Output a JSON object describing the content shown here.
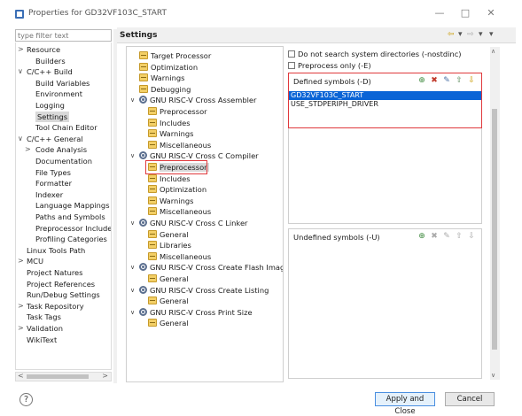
{
  "window": {
    "title": "Properties for GD32VF103C_START",
    "minimize": "—",
    "maximize": "□",
    "close": "✕"
  },
  "filter": {
    "placeholder": "type filter text"
  },
  "nav": {
    "items": [
      {
        "label": "Resource",
        "arrow": ">"
      },
      {
        "label": "Builders"
      },
      {
        "label": "C/C++ Build",
        "arrow": "∨"
      },
      {
        "label": "Build Variables"
      },
      {
        "label": "Environment"
      },
      {
        "label": "Logging"
      },
      {
        "label": "Settings"
      },
      {
        "label": "Tool Chain Editor"
      },
      {
        "label": "C/C++ General",
        "arrow": "∨"
      },
      {
        "label": "Code Analysis",
        "arrow": ">"
      },
      {
        "label": "Documentation"
      },
      {
        "label": "File Types"
      },
      {
        "label": "Formatter"
      },
      {
        "label": "Indexer"
      },
      {
        "label": "Language Mappings"
      },
      {
        "label": "Paths and Symbols"
      },
      {
        "label": "Preprocessor Include"
      },
      {
        "label": "Profiling Categories"
      },
      {
        "label": "Linux Tools Path"
      },
      {
        "label": "MCU",
        "arrow": ">"
      },
      {
        "label": "Project Natures"
      },
      {
        "label": "Project References"
      },
      {
        "label": "Run/Debug Settings"
      },
      {
        "label": "Task Repository",
        "arrow": ">"
      },
      {
        "label": "Task Tags"
      },
      {
        "label": "Validation",
        "arrow": ">"
      },
      {
        "label": "WikiText"
      }
    ]
  },
  "settings": {
    "title": "Settings",
    "nav_back": "⇦",
    "nav_menu": "▾",
    "nav_forward": "⇨"
  },
  "tool_tree": {
    "nodes": [
      {
        "label": "Target Processor"
      },
      {
        "label": "Optimization"
      },
      {
        "label": "Warnings"
      },
      {
        "label": "Debugging"
      },
      {
        "label": "GNU RISC-V Cross Assembler",
        "arrow": "∨"
      },
      {
        "label": "Preprocessor"
      },
      {
        "label": "Includes"
      },
      {
        "label": "Warnings"
      },
      {
        "label": "Miscellaneous"
      },
      {
        "label": "GNU RISC-V Cross C Compiler",
        "arrow": "∨"
      },
      {
        "label": "Preprocessor"
      },
      {
        "label": "Includes"
      },
      {
        "label": "Optimization"
      },
      {
        "label": "Warnings"
      },
      {
        "label": "Miscellaneous"
      },
      {
        "label": "GNU RISC-V Cross C Linker",
        "arrow": "∨"
      },
      {
        "label": "General"
      },
      {
        "label": "Libraries"
      },
      {
        "label": "Miscellaneous"
      },
      {
        "label": "GNU RISC-V Cross Create Flash Image",
        "arrow": "∨"
      },
      {
        "label": "General"
      },
      {
        "label": "GNU RISC-V Cross Create Listing",
        "arrow": "∨"
      },
      {
        "label": "General"
      },
      {
        "label": "GNU RISC-V Cross Print Size",
        "arrow": "∨"
      },
      {
        "label": "General"
      }
    ]
  },
  "options": {
    "nostdinc": "Do not search system directories (-nostdinc)",
    "preprocess_only": "Preprocess only (-E)"
  },
  "defined_symbols": {
    "label": "Defined symbols (-D)",
    "items": [
      "GD32VF103C_START",
      "USE_STDPERIPH_DRIVER"
    ]
  },
  "undefined_symbols": {
    "label": "Undefined symbols (-U)",
    "items": []
  },
  "buttons": {
    "help": "?",
    "apply_close": "Apply and Close",
    "cancel": "Cancel"
  },
  "scroll": {
    "up": "∧",
    "down": "∨",
    "left": "<",
    "right": ">"
  },
  "colors": {
    "highlight": "#e0393c",
    "selection": "#0a64d6"
  }
}
